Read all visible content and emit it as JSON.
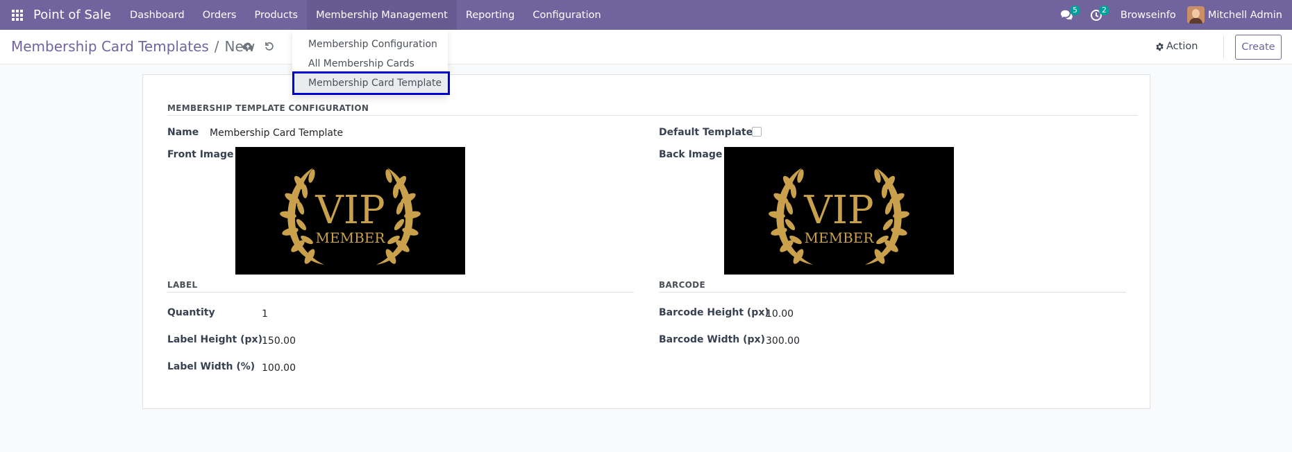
{
  "navbar": {
    "app_name": "Point of Sale",
    "menu": [
      "Dashboard",
      "Orders",
      "Products",
      "Membership Management",
      "Reporting",
      "Configuration"
    ],
    "messages_count": "5",
    "activities_count": "2",
    "company": "Browseinfo",
    "user": "Mitchell Admin"
  },
  "control_panel": {
    "breadcrumb_parent": "Membership Card Templates",
    "breadcrumb_separator": "/",
    "breadcrumb_current": "New",
    "action_label": "Action",
    "create_label": "Create"
  },
  "dropdown": {
    "items": [
      "Membership Configuration",
      "All Membership Cards",
      "Membership Card Template"
    ]
  },
  "form": {
    "section_config": "MEMBERSHIP TEMPLATE CONFIGURATION",
    "name_label": "Name",
    "name_value": "Membership Card Template",
    "default_label": "Default Template",
    "default_checked": false,
    "front_label": "Front Image",
    "back_label": "Back Image",
    "card_text_top": "VIP",
    "card_text_bottom": "MEMBER",
    "section_label": "LABEL",
    "section_barcode": "BARCODE",
    "quantity_label": "Quantity",
    "quantity_value": "1",
    "label_height_label": "Label Height (px)",
    "label_height_value": "150.00",
    "label_width_label": "Label Width (%)",
    "label_width_value": "100.00",
    "barcode_height_label": "Barcode Height (px)",
    "barcode_height_value": "10.00",
    "barcode_width_label": "Barcode Width (px)",
    "barcode_width_value": "300.00"
  },
  "colors": {
    "navbar": "#71639e",
    "highlight_outline": "#0000d6",
    "badge": "#00a09d",
    "gold": "#c9a04b"
  }
}
